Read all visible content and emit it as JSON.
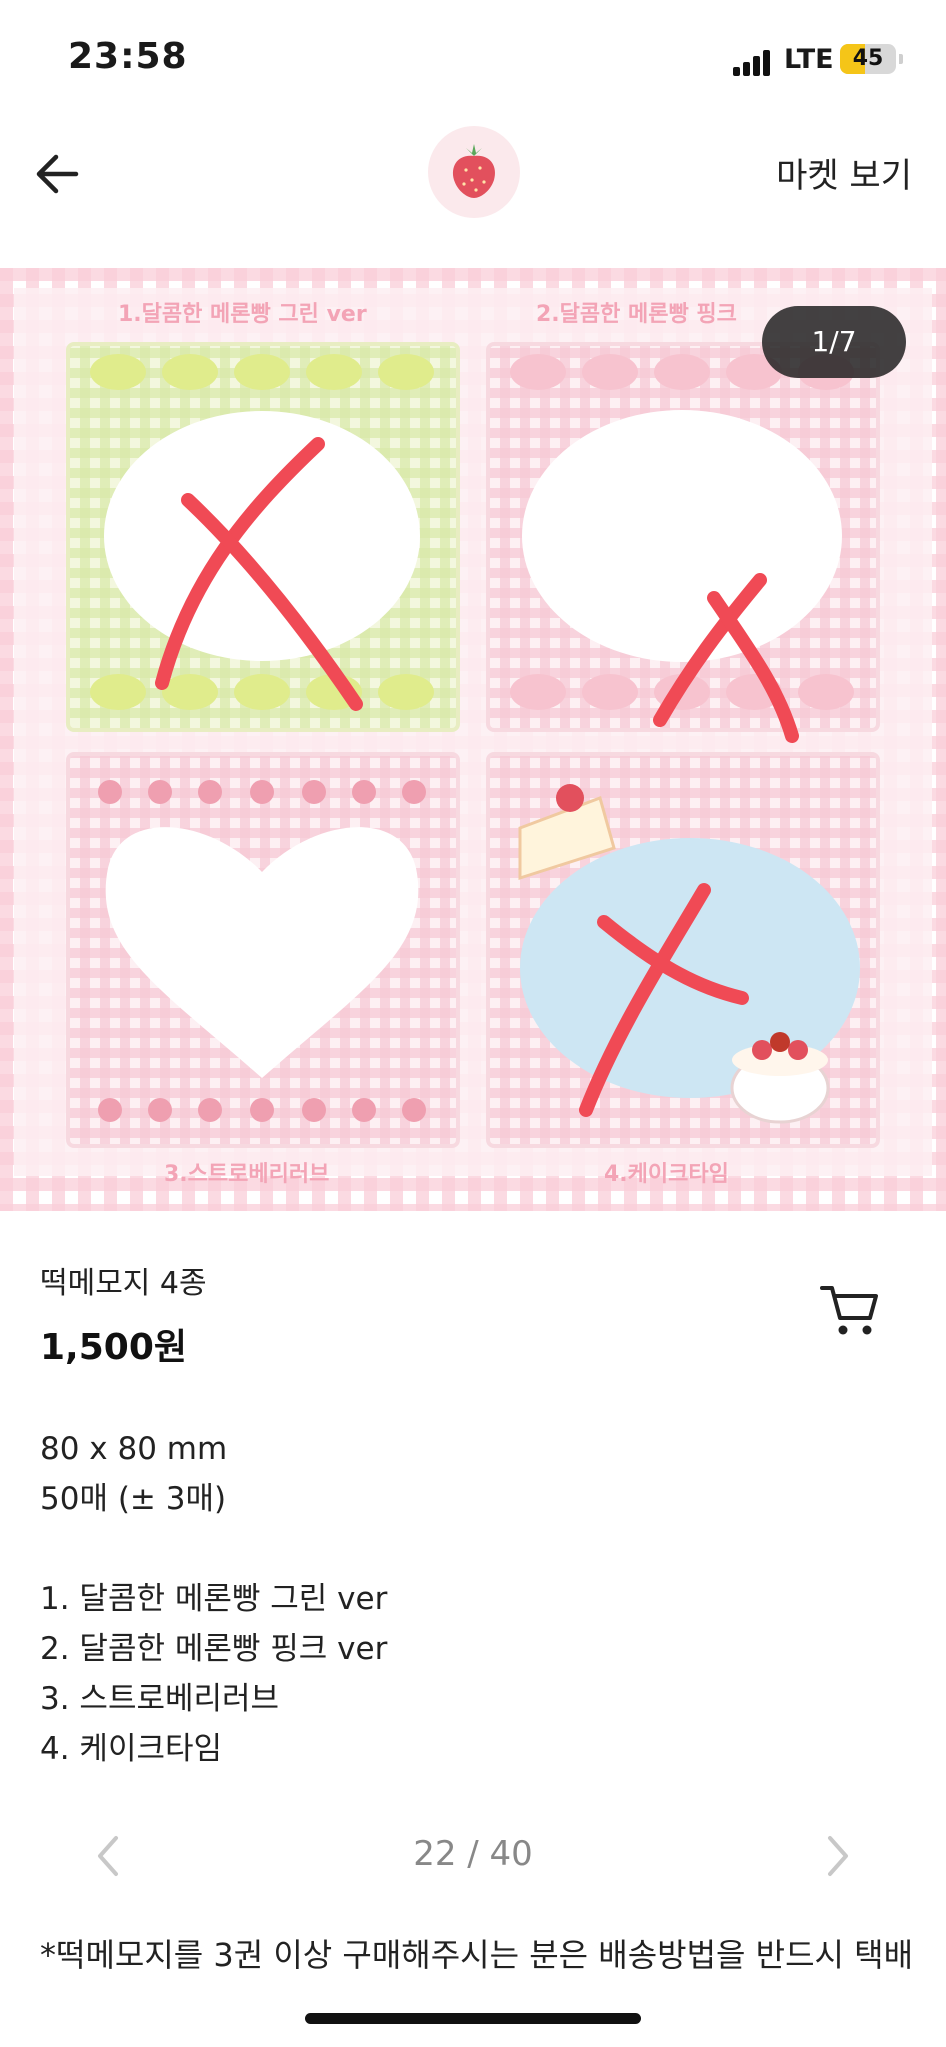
{
  "status_bar": {
    "time": "23:58",
    "network": "LTE",
    "battery_level": "45",
    "battery_fraction": 0.45
  },
  "nav": {
    "back_icon": "arrow-left-icon",
    "logo_icon": "strawberry-icon",
    "market_link": "마켓 보기"
  },
  "image": {
    "counter": "1/7",
    "panels": [
      "1.달콤한 메론빵 그린 ver",
      "2.달콤한 메론빵 핑크",
      "3.스트로베리러브",
      "4.케이크타임"
    ],
    "mark_color": "#f04a55"
  },
  "product": {
    "title": "떡메모지 4종",
    "price": "1,500원",
    "cart_icon": "cart-icon",
    "description": [
      "80 x 80 mm",
      "50매 (± 3매)",
      "",
      "1. 달콤한 메론빵 그린 ver",
      "2. 달콤한 메론빵 핑크 ver",
      "3. 스트로베리러브",
      "4. 케이크타임"
    ]
  },
  "pager": {
    "count": "22 / 40",
    "prev_icon": "chevron-left-icon",
    "next_icon": "chevron-right-icon"
  },
  "notice": "*떡메모지를 3권 이상 구매해주시는 분은 배송방법을 반드시 택배"
}
